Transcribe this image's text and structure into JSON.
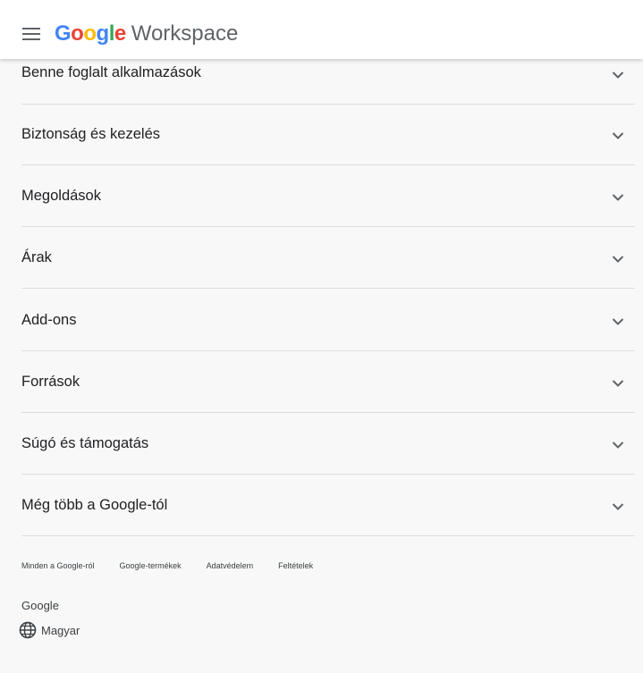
{
  "header": {
    "menu_icon": "hamburger-menu-icon",
    "logo_letters": [
      {
        "char": "G",
        "color": "#4285F4"
      },
      {
        "char": "o",
        "color": "#EA4335"
      },
      {
        "char": "o",
        "color": "#FBBC05"
      },
      {
        "char": "g",
        "color": "#4285F4"
      },
      {
        "char": "l",
        "color": "#34A853"
      },
      {
        "char": "e",
        "color": "#EA4335"
      }
    ],
    "product": "Workspace"
  },
  "sections": [
    {
      "label": "Benne foglalt alkalmazások"
    },
    {
      "label": "Biztonság és kezelés"
    },
    {
      "label": "Megoldások"
    },
    {
      "label": "Árak"
    },
    {
      "label": "Add-ons"
    },
    {
      "label": "Források"
    },
    {
      "label": "Súgó és támogatás"
    },
    {
      "label": "Még több a Google-tól"
    }
  ],
  "footer": {
    "links": [
      "Minden a Google-ról",
      "Google-termékek",
      "Adatvédelem",
      "Feltételek"
    ],
    "brand": "Google",
    "language": {
      "icon": "globe-icon",
      "label": "Magyar"
    }
  }
}
